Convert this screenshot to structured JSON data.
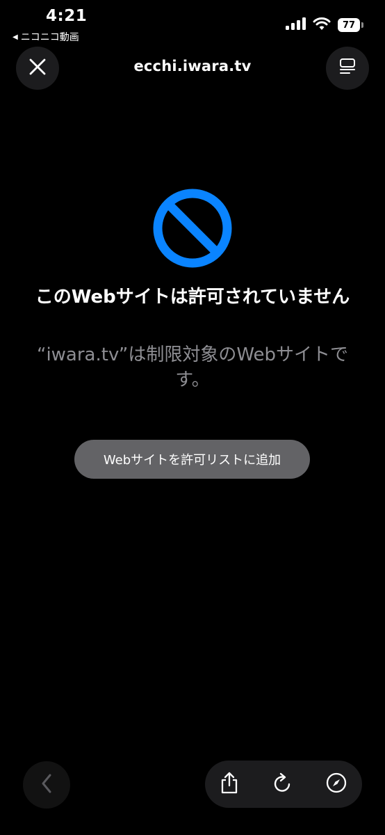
{
  "status_bar": {
    "time": "4:21",
    "back_app": "ニコニコ動画",
    "battery": "77",
    "icons": [
      "signal-icon",
      "wifi-icon",
      "battery-icon"
    ]
  },
  "top_bar": {
    "domain": "ecchi.iwara.tv",
    "icons": [
      "close-icon",
      "reader-icon"
    ]
  },
  "main": {
    "title": "このWebサイトは許可されていません",
    "description": "“iwara.tv”は制限対象のWebサイトです。",
    "allow_button": "Webサイトを許可リストに追加",
    "icon": "blocked-icon",
    "accent_color": "#0a84ff"
  },
  "toolbar": {
    "icons": [
      "back-icon",
      "share-icon",
      "reload-icon",
      "compass-icon"
    ]
  }
}
